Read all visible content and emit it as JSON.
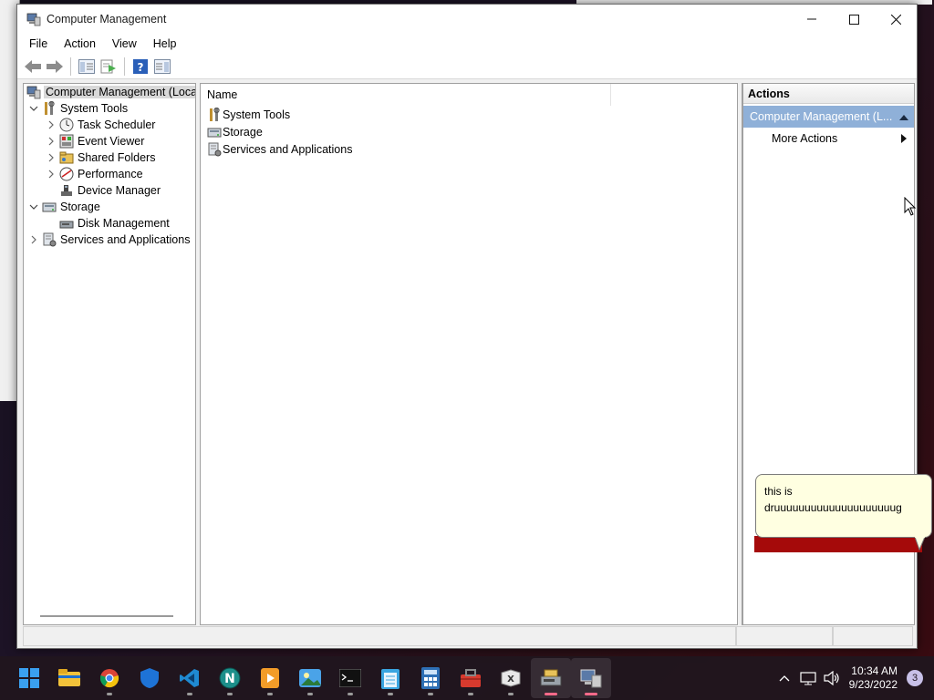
{
  "window": {
    "title": "Computer Management"
  },
  "menu": [
    "File",
    "Action",
    "View",
    "Help"
  ],
  "tree": {
    "root": "Computer Management (Local",
    "items": [
      {
        "label": "System Tools"
      },
      {
        "label": "Task Scheduler"
      },
      {
        "label": "Event Viewer"
      },
      {
        "label": "Shared Folders"
      },
      {
        "label": "Performance"
      },
      {
        "label": "Device Manager"
      },
      {
        "label": "Storage"
      },
      {
        "label": "Disk Management"
      },
      {
        "label": "Services and Applications"
      }
    ]
  },
  "list": {
    "column_name": "Name",
    "rows": [
      "System Tools",
      "Storage",
      "Services and Applications"
    ]
  },
  "actions": {
    "title": "Actions",
    "section": "Computer Management (L...",
    "items": [
      "More Actions"
    ]
  },
  "tooltip": {
    "text_line1": "this is",
    "text_line2": "druuuuuuuuuuuuuuuuuuuug"
  },
  "taskbar": {
    "time": "10:34 AM",
    "date": "9/23/2022",
    "notification_count": "3"
  },
  "colors": {
    "selection_blue": "#8fb0d8",
    "tooltip_bg": "#ffffe1",
    "taskbar_bg": "#20161e"
  }
}
